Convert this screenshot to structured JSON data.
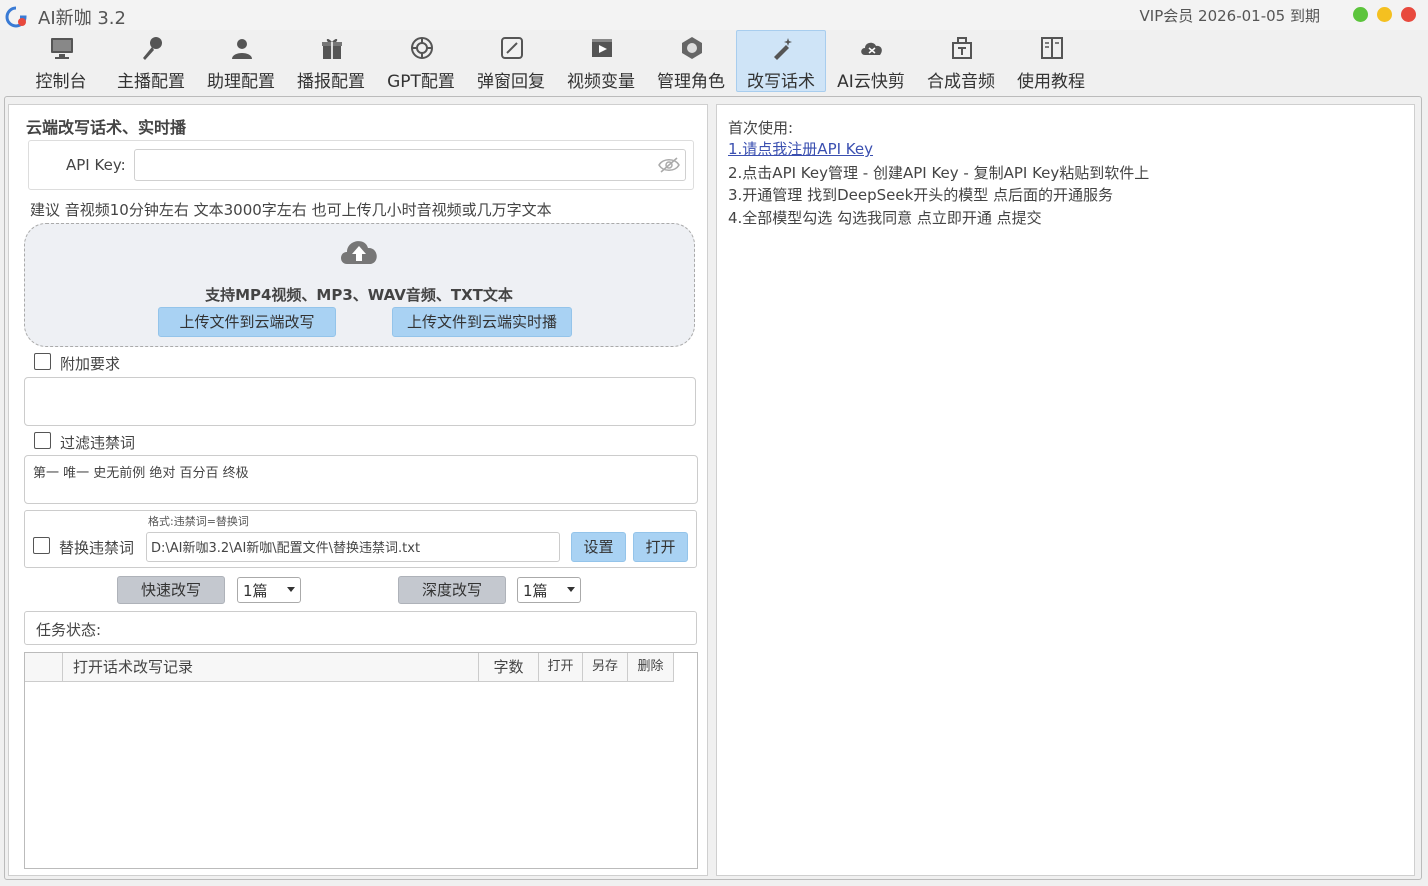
{
  "window": {
    "title": "AI新咖 3.2",
    "vip": "VIP会员 2026-01-05 到期"
  },
  "toolbar": [
    {
      "label": "控制台",
      "icon": "monitor-icon"
    },
    {
      "label": "主播配置",
      "icon": "microphone-icon"
    },
    {
      "label": "助理配置",
      "icon": "user-icon"
    },
    {
      "label": "播报配置",
      "icon": "gift-icon"
    },
    {
      "label": "GPT配置",
      "icon": "openai-icon"
    },
    {
      "label": "弹窗回复",
      "icon": "edit-box-icon"
    },
    {
      "label": "视频变量",
      "icon": "video-icon"
    },
    {
      "label": "管理角色",
      "icon": "role-icon"
    },
    {
      "label": "改写话术",
      "icon": "magic-pen-icon",
      "active": true
    },
    {
      "label": "AI云快剪",
      "icon": "cloud-scissors-icon"
    },
    {
      "label": "合成音频",
      "icon": "audio-mix-icon"
    },
    {
      "label": "使用教程",
      "icon": "book-icon"
    }
  ],
  "left": {
    "section_title": "云端改写话术、实时播",
    "api_key_label": "API Key:",
    "api_key_value": "",
    "hint": "建议 音视频10分钟左右 文本3000字左右   也可上传几小时音视频或几万字文本",
    "upload": {
      "support_text": "支持MP4视频、MP3、WAV音频、TXT文本",
      "btn_rewrite": "上传文件到云端改写",
      "btn_live": "上传文件到云端实时播"
    },
    "extra_req_label": "附加要求",
    "extra_req_value": "",
    "filter_label": "过滤违禁词",
    "filter_words": "第一 唯一 史无前例 绝对 百分百 终极",
    "replace_label": "替换违禁词",
    "replace_format": "格式:违禁词=替换词",
    "replace_path": "D:\\AI新咖3.2\\AI新咖\\配置文件\\替换违禁词.txt",
    "set_btn": "设置",
    "open_btn": "打开",
    "fast_btn": "快速改写",
    "fast_count": "1篇",
    "deep_btn": "深度改写",
    "deep_count": "1篇",
    "status_label": "任务状态:",
    "table_headers": {
      "record": "打开话术改写记录",
      "words": "字数",
      "open": "打开",
      "saveas": "另存",
      "delete": "删除"
    }
  },
  "right": {
    "intro": "首次使用:",
    "step1": "1.请点我注册API Key",
    "step2": "2.点击API Key管理 - 创建API Key - 复制API Key粘贴到软件上",
    "step3": "3.开通管理 找到DeepSeek开头的模型 点后面的开通服务",
    "step4": "4.全部模型勾选 勾选我同意 点立即开通 点提交"
  },
  "colors": {
    "active_tab": "#cfe4f7",
    "button_blue": "#a9d2f3",
    "button_gray": "#c4c8cf",
    "link": "#3a4fb0"
  }
}
